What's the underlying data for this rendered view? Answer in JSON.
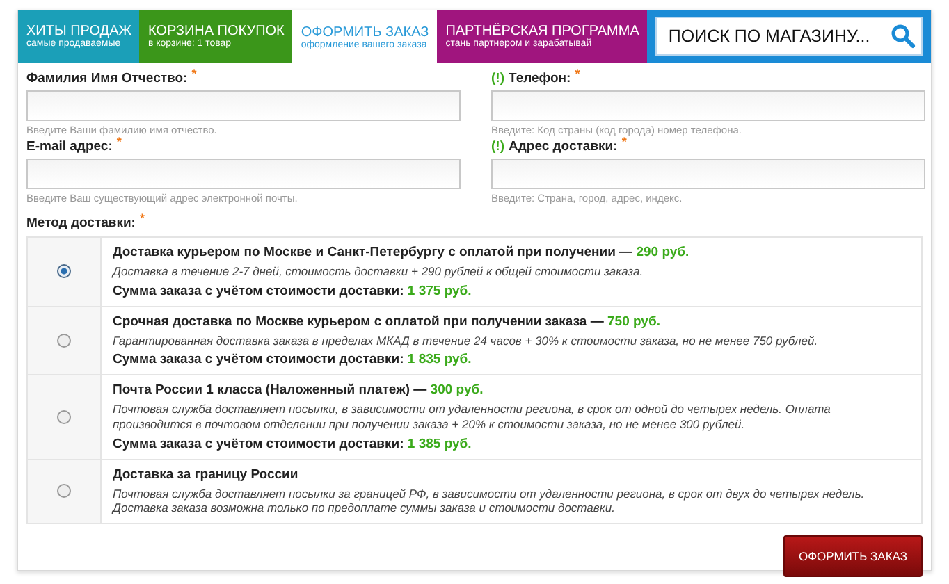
{
  "tabs": [
    {
      "title": "ХИТЫ ПРОДАЖ",
      "subtitle": "самые продаваемые",
      "color": "#1b9fb8",
      "selected": false
    },
    {
      "title": "КОРЗИНА ПОКУПОК",
      "subtitle": "в корзине: 1 товар",
      "color": "#3b961a",
      "selected": false
    },
    {
      "title": "ОФОРМИТЬ ЗАКАЗ",
      "subtitle": "оформление вашего заказа",
      "selected": true
    },
    {
      "title": "ПАРТНЁРСКАЯ ПРОГРАММА",
      "subtitle": "стань партнером и зарабатывай",
      "color": "#a0157e",
      "selected": false
    }
  ],
  "search": {
    "placeholder": "ПОИСК ПО МАГАЗИНУ..."
  },
  "fields": [
    {
      "label": "Фамилия Имя Отчество:",
      "required_mark": "*",
      "hint": "Введите Ваши фамилию имя отчество."
    },
    {
      "marker": "(!)",
      "label": "Телефон:",
      "required_mark": "*",
      "hint": "Введите: Код страны (код города) номер телефона."
    },
    {
      "label": "E-mail адрес:",
      "required_mark": "*",
      "hint": "Введите Ваш существующий адрес электронной почты."
    },
    {
      "marker": "(!)",
      "label": "Адрес доставки:",
      "required_mark": "*",
      "hint": "Введите: Страна, город, адрес, индекс."
    }
  ],
  "delivery": {
    "label": "Метод доставки:",
    "required_mark": "*",
    "options": [
      {
        "title": "Доставка курьером по Москве и Санкт-Петербургу с оплатой при получении —",
        "price": "290 руб.",
        "description": "Доставка в течение 2-7 дней, стоимость доставки + 290 рублей к общей стоимости заказа.",
        "total_label": "Сумма заказа с учётом стоимости доставки:",
        "total_value": "1 375 руб.",
        "selected": true
      },
      {
        "title": "Срочная доставка по Москве курьером с оплатой при получении заказа —",
        "price": "750 руб.",
        "description": "Гарантированная доставка заказа в пределах МКАД в течение 24 часов + 30% к стоимости заказа, но не менее 750 рублей.",
        "total_label": "Сумма заказа с учётом стоимости доставки:",
        "total_value": "1 835 руб.",
        "selected": false
      },
      {
        "title": "Почта России 1 класса (Наложенный платеж) —",
        "price": "300 руб.",
        "description": "Почтовая служба доставляет посылки, в зависимости от удаленности региона, в срок от одной до четырех недель. Оплата производится в почтовом отделении при получении заказа + 20% к стоимости заказа, но не менее 300 рублей.",
        "total_label": "Сумма заказа с учётом стоимости доставки:",
        "total_value": "1 385 руб.",
        "selected": false
      },
      {
        "title": "Доставка за границу России",
        "description": "Почтовая служба доставляет посылки за границей РФ, в зависимости от удаленности региона, в срок от двух до четырех недель. Доставка заказа возможна только по предоплате суммы заказа и стоимости доставки.",
        "selected": false
      }
    ]
  },
  "submit": {
    "label": "ОФОРМИТЬ ЗАКАЗ"
  }
}
